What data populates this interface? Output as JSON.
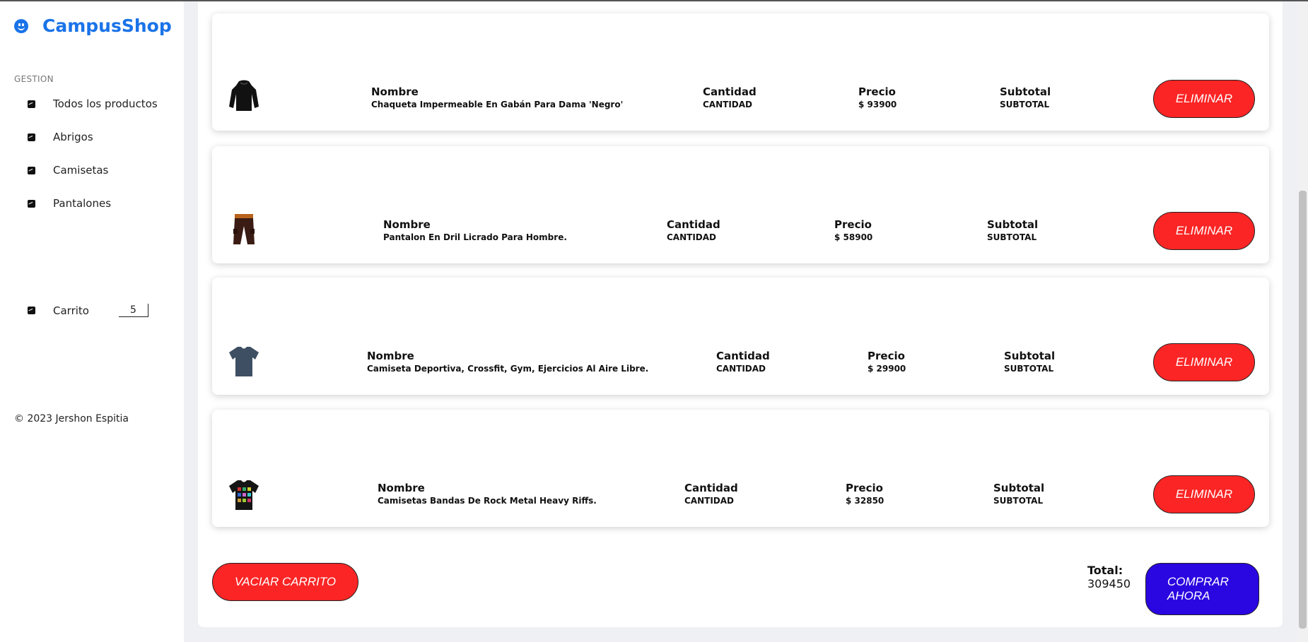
{
  "brand": {
    "name": "CampusShop"
  },
  "sidebar": {
    "section_label": "GESTION",
    "items": [
      {
        "label": "Todos los productos"
      },
      {
        "label": "Abrigos"
      },
      {
        "label": "Camisetas"
      },
      {
        "label": "Pantalones"
      }
    ],
    "cart": {
      "label": "Carrito",
      "count": "5"
    },
    "footer": "© 2023 Jershon Espitia"
  },
  "cart_items": [
    {
      "name_label": "Nombre",
      "name": "Chaqueta Impermeable En Gabán Para Dama 'Negro'",
      "qty_label": "Cantidad",
      "qty": "CANTIDAD",
      "price_label": "Precio",
      "price": "$ 93900",
      "subtotal_label": "Subtotal",
      "subtotal": "SUBTOTAL",
      "remove_label": "ELIMINAR"
    },
    {
      "name_label": "Nombre",
      "name": "Pantalon En Dril Licrado Para Hombre.",
      "qty_label": "Cantidad",
      "qty": "CANTIDAD",
      "price_label": "Precio",
      "price": "$ 58900",
      "subtotal_label": "Subtotal",
      "subtotal": "SUBTOTAL",
      "remove_label": "ELIMINAR"
    },
    {
      "name_label": "Nombre",
      "name": "Camiseta Deportiva, Crossfit, Gym, Ejercicios Al Aire Libre.",
      "qty_label": "Cantidad",
      "qty": "CANTIDAD",
      "price_label": "Precio",
      "price": "$ 29900",
      "subtotal_label": "Subtotal",
      "subtotal": "SUBTOTAL",
      "remove_label": "ELIMINAR"
    },
    {
      "name_label": "Nombre",
      "name": "Camisetas Bandas De Rock Metal Heavy Riffs.",
      "qty_label": "Cantidad",
      "qty": "CANTIDAD",
      "price_label": "Precio",
      "price": "$ 32850",
      "subtotal_label": "Subtotal",
      "subtotal": "SUBTOTAL",
      "remove_label": "ELIMINAR"
    }
  ],
  "actions": {
    "clear_label": "VACIAR CARRITO",
    "total_label": "Total:",
    "total_value": "309450",
    "buy_label_line1": "COMPRAR",
    "buy_label_line2": "AHORA"
  },
  "colors": {
    "brand": "#1a73e8",
    "danger": "#fb2525",
    "primary": "#2a06e0"
  }
}
